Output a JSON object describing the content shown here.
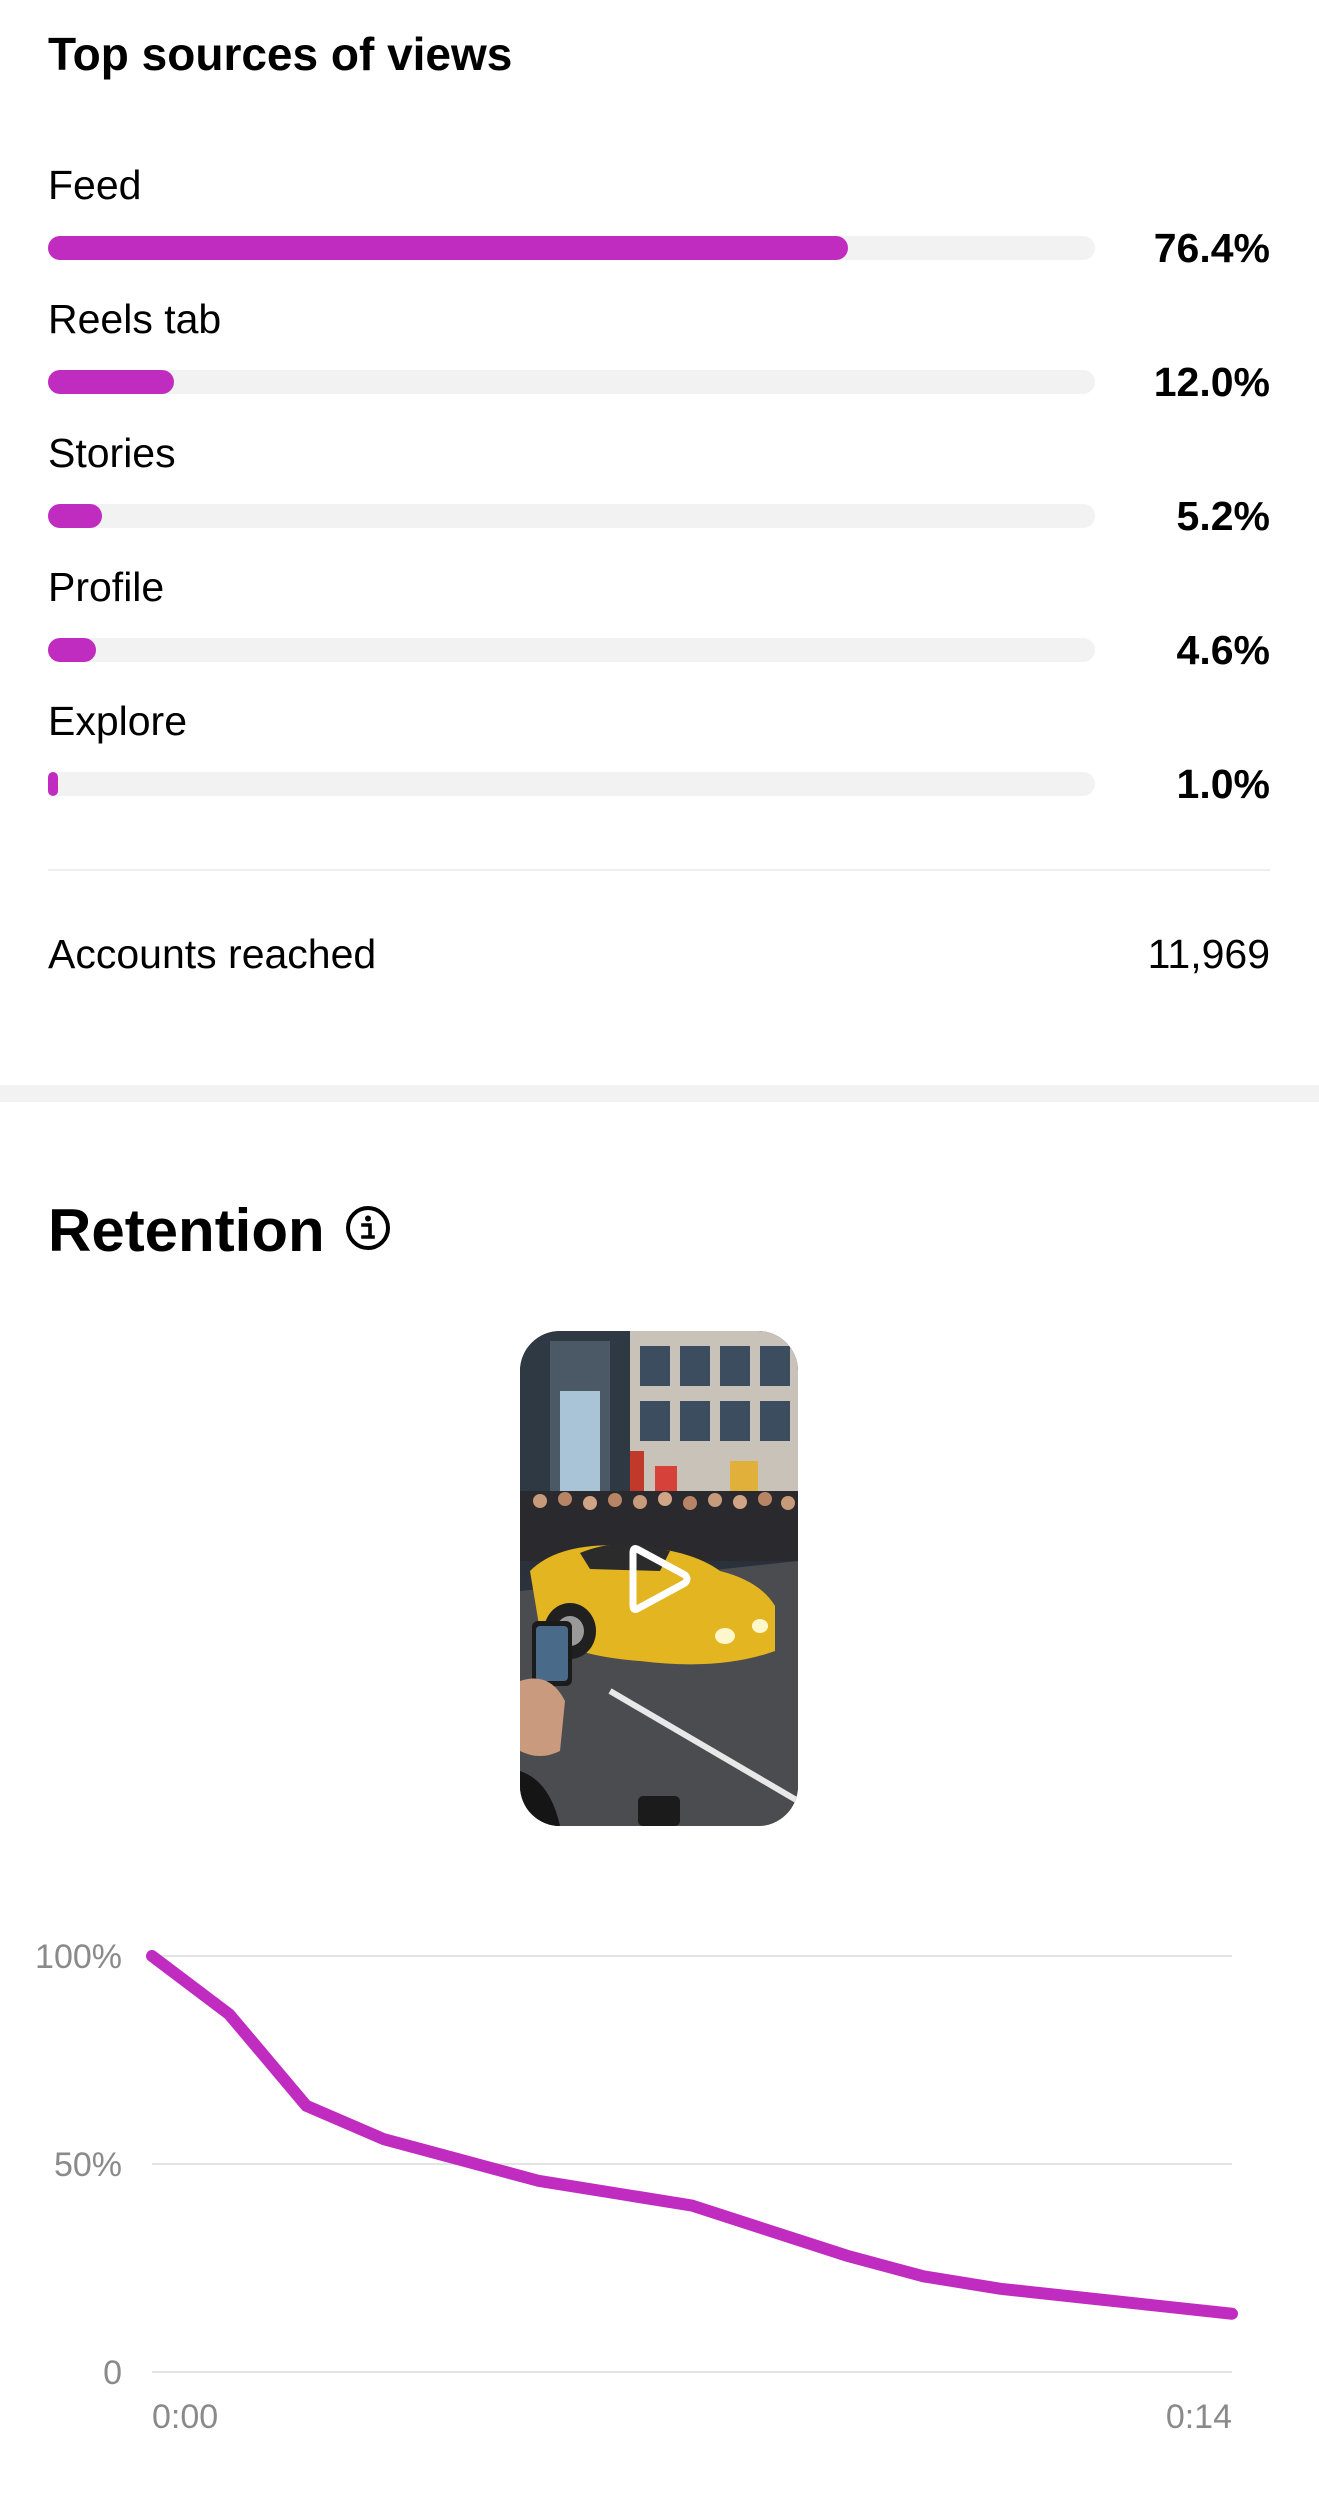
{
  "top_sources": {
    "title": "Top sources of views",
    "items": [
      {
        "label": "Feed",
        "percent_text": "76.4%",
        "value": 76.4
      },
      {
        "label": "Reels tab",
        "percent_text": "12.0%",
        "value": 12.0
      },
      {
        "label": "Stories",
        "percent_text": "5.2%",
        "value": 5.2
      },
      {
        "label": "Profile",
        "percent_text": "4.6%",
        "value": 4.6
      },
      {
        "label": "Explore",
        "percent_text": "1.0%",
        "value": 1.0
      }
    ],
    "bar_color": "#c02cc0",
    "track_color": "#f2f2f2"
  },
  "accounts_reached": {
    "label": "Accounts reached",
    "value": "11,969"
  },
  "retention": {
    "title": "Retention",
    "info_icon": "info-icon",
    "thumbnail": {
      "description_icon": "play-icon"
    }
  },
  "chart_data": {
    "type": "line",
    "title": "",
    "xlabel": "",
    "ylabel": "",
    "x_tick_labels": [
      "0:00",
      "0:14"
    ],
    "y_tick_labels": [
      "100%",
      "50%",
      "0"
    ],
    "y_tick_values": [
      100,
      50,
      0
    ],
    "xlim": [
      0,
      14
    ],
    "ylim": [
      0,
      100
    ],
    "grid": true,
    "line_color": "#c02cc0",
    "series": [
      {
        "x": [
          0,
          1,
          2,
          3,
          4,
          5,
          6,
          7,
          8,
          9,
          10,
          11,
          12,
          13,
          14
        ],
        "values": [
          100,
          86,
          64,
          56,
          51,
          46,
          43,
          40,
          34,
          28,
          23,
          20,
          18,
          16,
          14
        ]
      }
    ]
  }
}
